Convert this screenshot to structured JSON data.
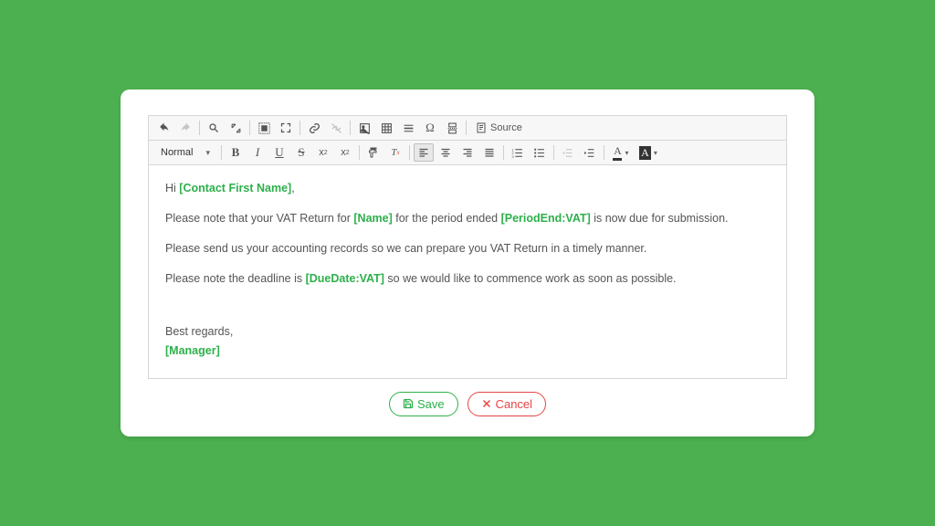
{
  "toolbar": {
    "format_label": "Normal",
    "source_label": "Source"
  },
  "body": {
    "greeting_prefix": "Hi ",
    "greeting_token": "[Contact First Name]",
    "greeting_suffix": ",",
    "p1_a": "Please note that your VAT Return for ",
    "p1_token1": "[Name]",
    "p1_b": " for the period ended ",
    "p1_token2": "[PeriodEnd:VAT]",
    "p1_c": " is now due for submission.",
    "p2": "Please send us your accounting records so we can prepare you VAT Return in a timely manner.",
    "p3_a": "Please note the deadline is ",
    "p3_token": "[DueDate:VAT]",
    "p3_b": " so we would like to commence work as soon as possible.",
    "signoff": "Best regards,",
    "signer_token": "[Manager]"
  },
  "buttons": {
    "save": "Save",
    "cancel": "Cancel"
  }
}
